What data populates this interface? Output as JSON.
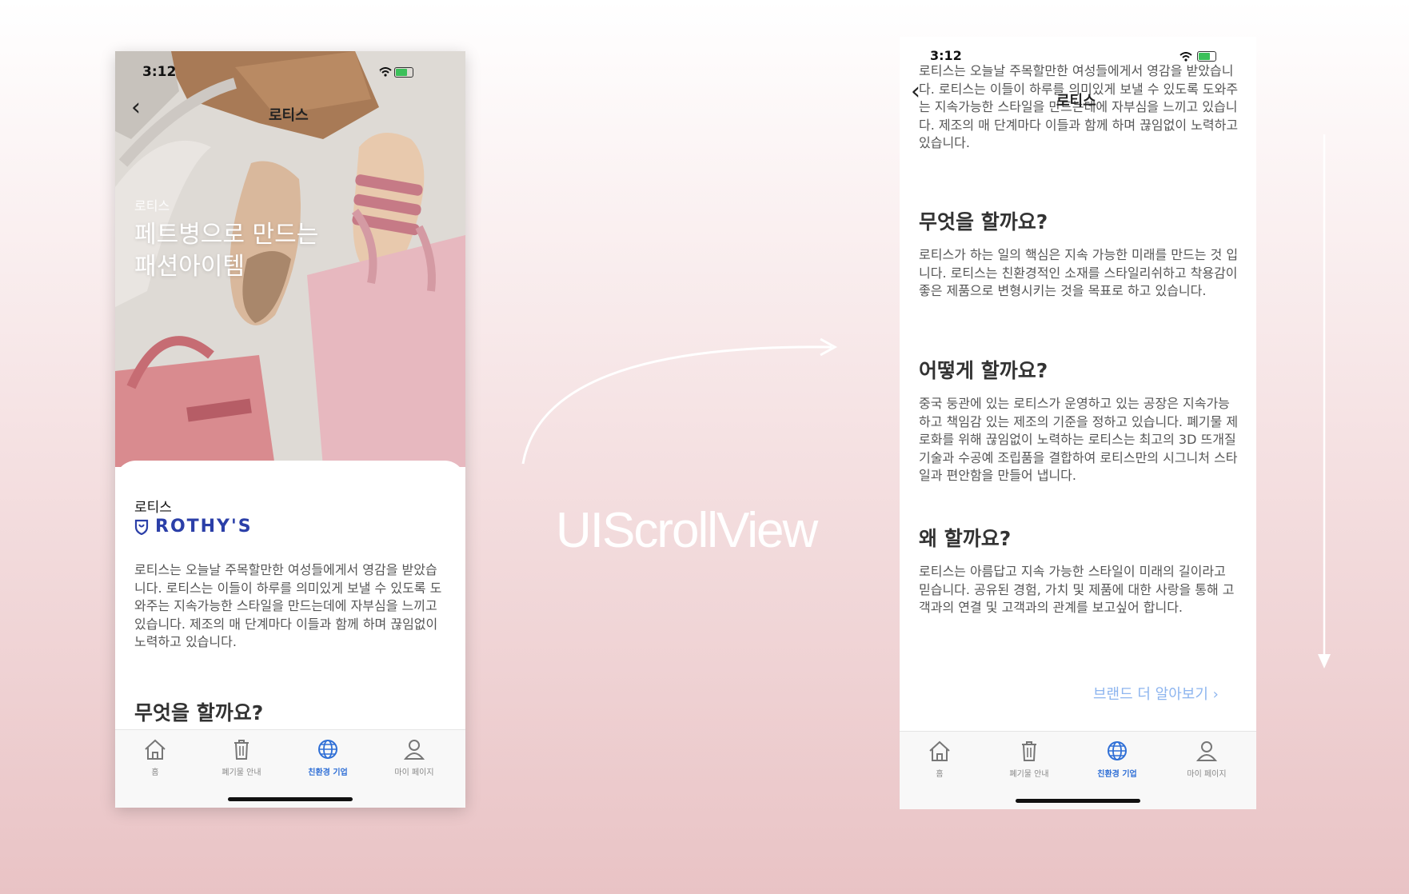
{
  "status": {
    "time": "3:12"
  },
  "nav": {
    "title": "로티스"
  },
  "hero": {
    "brand": "로티스",
    "title": "페트병으로 만드는 패션아이템"
  },
  "card": {
    "brand_label": "로티스",
    "logo_text": "ROTHY'S",
    "intro": "로티스는 오늘날 주목할만한 여성들에게서 영감을 받았습니다. 로티스는 이들이 하루를 의미있게 보낼 수 있도록 도와주는 지속가능한 스타일을 만드는데에 자부심을 느끼고 있습니다. 제조의 매 단계마다 이들과 함께 하며 끊임없이 노력하고 있습니다."
  },
  "sections": [
    {
      "heading": "무엇을 할까요?",
      "body": "로티스가 하는 일의 핵심은 지속 가능한 미래를 만드는 것 입니다. 로티스는 친환경적인 소재를 스타일리쉬하고 착용감이 좋은 제품으로 변형시키는 것을 목표로 하고 있습니다."
    },
    {
      "heading": "어떻게 할까요?",
      "body": "중국 둥관에 있는 로티스가 운영하고 있는 공장은 지속가능하고 책임감 있는 제조의 기준을 정하고 있습니다. 폐기물 제로화를 위해 끊임없이 노력하는 로티스는 최고의 3D 뜨개질 기술과 수공예 조립품을 결합하여 로티스만의 시그니처 스타일과 편안함을 만들어 냅니다."
    },
    {
      "heading": "왜 할까요?",
      "body": "로티스는 아름답고 지속 가능한 스타일이 미래의 길이라고 믿습니다. 공유된 경험, 가치 및 제품에 대한 사랑을 통해 고객과의 연결 및 고객과의 관계를 보고싶어 합니다."
    }
  ],
  "brand_link": "브랜드 더 알아보기",
  "tabs": [
    {
      "label": "홈",
      "icon": "home-icon",
      "active": false
    },
    {
      "label": "폐기물 안내",
      "icon": "trash-icon",
      "active": false
    },
    {
      "label": "친환경 기업",
      "icon": "globe-icon",
      "active": true
    },
    {
      "label": "마이 페이지",
      "icon": "person-icon",
      "active": false
    }
  ],
  "center_label": "UIScrollView",
  "colors": {
    "accent": "#2f6fd6",
    "logo": "#2b3fa8",
    "link": "#8db5ef"
  }
}
